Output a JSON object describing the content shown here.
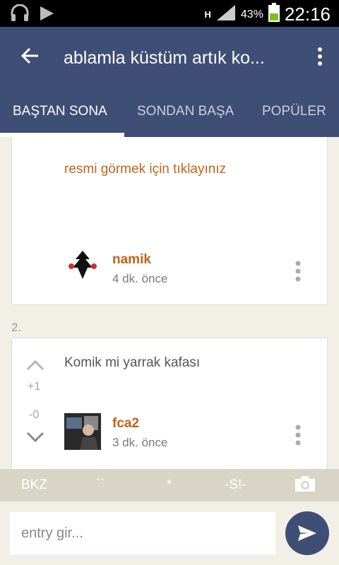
{
  "status_bar": {
    "network_type": "H",
    "battery_percent": "43%",
    "time": "22:16"
  },
  "app_bar": {
    "title": "ablamla küstüm artık ko...",
    "tabs": [
      {
        "label": "BAŞTAN SONA",
        "active": true
      },
      {
        "label": "SONDAN BAŞA",
        "active": false
      },
      {
        "label": "POPÜLER",
        "active": false
      }
    ]
  },
  "entries": [
    {
      "text": "resmi görmek için tıklayınız",
      "author": "namik",
      "time": "4 dk. önce"
    },
    {
      "index": "2.",
      "text": "Komik mi yarrak kafası",
      "author": "fca2",
      "time": "3 dk. önce",
      "upvotes": "+1",
      "downvotes": "-0"
    }
  ],
  "bbcode_bar": {
    "buttons": [
      "BKZ",
      "``",
      "*",
      "-S!-"
    ]
  },
  "composer": {
    "placeholder": "entry gir..."
  },
  "colors": {
    "primary": "#3e4e74",
    "accent": "#c0641a",
    "background": "#f1efe6"
  }
}
